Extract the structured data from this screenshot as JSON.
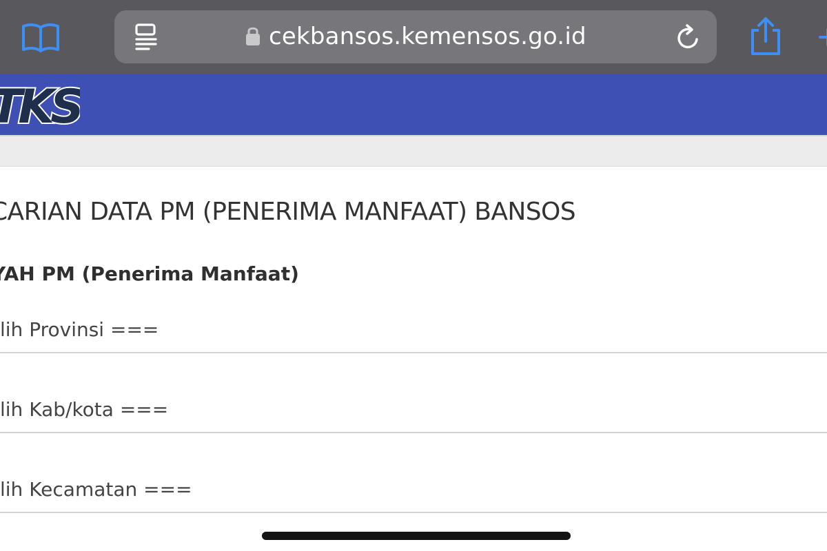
{
  "browser": {
    "url": "cekbansos.kemensos.go.id",
    "icons": {
      "bookmarks": "open-book-icon",
      "reader": "reader-mode-icon",
      "lock": "lock-icon",
      "reload": "reload-icon",
      "share": "share-icon",
      "new_tab": "plus-icon"
    },
    "accent_color": "#3d8ff5"
  },
  "site": {
    "header_color": "#3f50b5",
    "logo_text": "TKS"
  },
  "page": {
    "title": "CARIAN DATA PM (PENERIMA MANFAAT) BANSOS",
    "section_label": "YAH PM (Penerima Manfaat)",
    "selects": {
      "provinsi": "lih Provinsi ===",
      "kabkota": "lih Kab/kota ===",
      "kecamatan": "lih Kecamatan ==="
    }
  }
}
